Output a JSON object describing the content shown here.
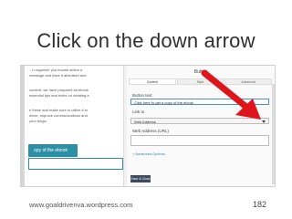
{
  "slide": {
    "title": "Click on the down arrow",
    "footer_url": "www.goaldrivenva.wordpress.com",
    "page_number": "182"
  },
  "editor": {
    "lines": [
      "...n orgarizer you mouse action a",
      "message and have it absorbed and",
      "",
      "content, we have prepared an ebook",
      "essential tips and tricks on creating a",
      "",
      "e these and make sure to utilize it to",
      "ience, improve communications and",
      "your blogs."
    ],
    "ebook_button_label": "opy of the ebook"
  },
  "modal": {
    "title": "Button",
    "tabs": [
      "Content",
      "Style",
      "Advanced"
    ],
    "active_tab": "Content",
    "button_text_label": "Button text",
    "button_text_value": "Click here to get a copy of the ebook",
    "link_to_label": "Link to",
    "link_to_value": "Web Address",
    "web_address_label": "Web Address (URL)",
    "web_address_value": "",
    "advanced_options": "+ Advanced Options",
    "save_label": "Save & Close"
  },
  "colors": {
    "annotation_arrow": "#e0151b",
    "accent_teal": "#2c8fa5",
    "save_button": "#3d4a5c"
  }
}
